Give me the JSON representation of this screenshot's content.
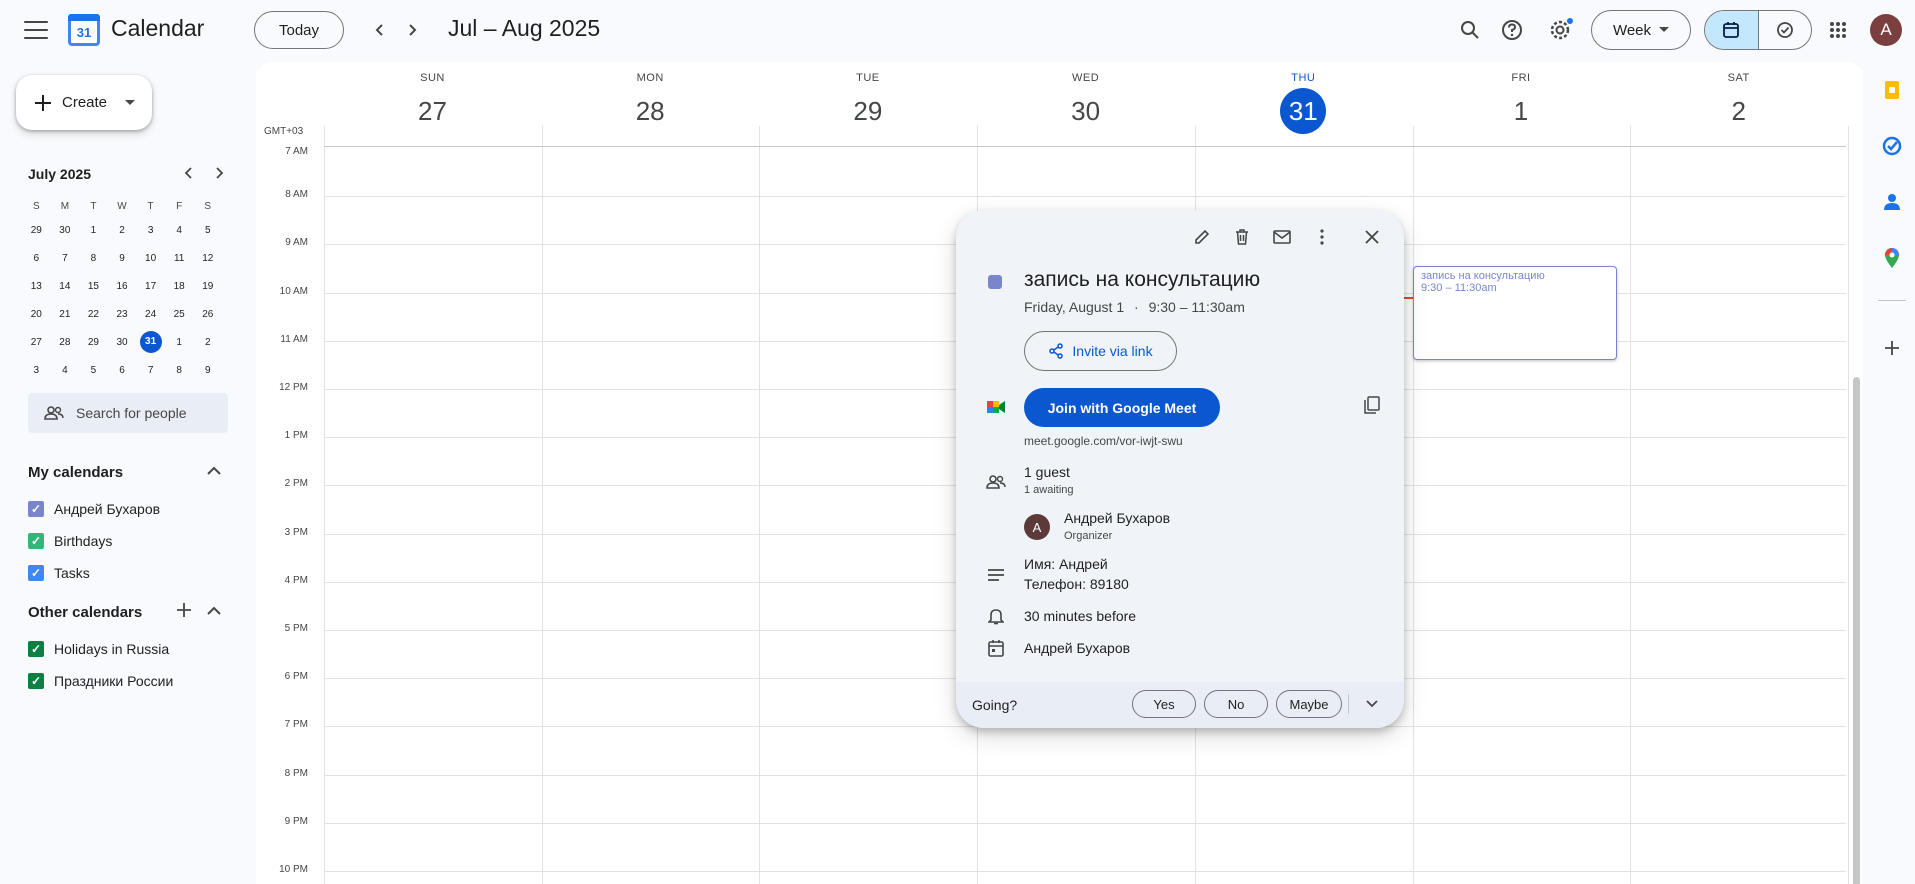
{
  "app": {
    "title": "Calendar",
    "logo_day": "31"
  },
  "toolbar": {
    "today": "Today",
    "date_range": "Jul – Aug 2025",
    "view": "Week",
    "avatar_letter": "A"
  },
  "sidebar": {
    "create": "Create",
    "mini_month": "July 2025",
    "mini_weekdays": [
      "S",
      "M",
      "T",
      "W",
      "T",
      "F",
      "S"
    ],
    "mini_weeks": [
      [
        "29",
        "30",
        "1",
        "2",
        "3",
        "4",
        "5"
      ],
      [
        "6",
        "7",
        "8",
        "9",
        "10",
        "11",
        "12"
      ],
      [
        "13",
        "14",
        "15",
        "16",
        "17",
        "18",
        "19"
      ],
      [
        "20",
        "21",
        "22",
        "23",
        "24",
        "25",
        "26"
      ],
      [
        "27",
        "28",
        "29",
        "30",
        "31",
        "1",
        "2"
      ],
      [
        "3",
        "4",
        "5",
        "6",
        "7",
        "8",
        "9"
      ]
    ],
    "search_people": "Search for people",
    "my_calendars_title": "My calendars",
    "my_calendars": [
      {
        "label": "Андрей Бухаров",
        "color": "#7986cb"
      },
      {
        "label": "Birthdays",
        "color": "#33b679"
      },
      {
        "label": "Tasks",
        "color": "#4285f4"
      }
    ],
    "other_calendars_title": "Other calendars",
    "other_calendars": [
      {
        "label": "Holidays in Russia",
        "color": "#0b8043"
      },
      {
        "label": "Праздники России",
        "color": "#0b8043"
      }
    ]
  },
  "week": {
    "timezone": "GMT+03",
    "days": [
      {
        "name": "SUN",
        "date": "27"
      },
      {
        "name": "MON",
        "date": "28"
      },
      {
        "name": "TUE",
        "date": "29"
      },
      {
        "name": "WED",
        "date": "30"
      },
      {
        "name": "THU",
        "date": "31",
        "today": true
      },
      {
        "name": "FRI",
        "date": "1"
      },
      {
        "name": "SAT",
        "date": "2"
      }
    ],
    "hours": [
      "7 AM",
      "8 AM",
      "9 AM",
      "10 AM",
      "11 AM",
      "12 PM",
      "1 PM",
      "2 PM",
      "3 PM",
      "4 PM",
      "5 PM",
      "6 PM",
      "7 PM",
      "8 PM",
      "9 PM",
      "10 PM"
    ]
  },
  "event": {
    "title": "запись на консультацию",
    "time": "9:30 – 11:30am",
    "color": "#7986cb"
  },
  "popup": {
    "title": "запись на консультацию",
    "date": "Friday, August 1",
    "separator": "·",
    "time": "9:30 – 11:30am",
    "invite": "Invite via link",
    "meet_button": "Join with Google Meet",
    "meet_link": "meet.google.com/vor-iwjt-swu",
    "guests": "1 guest",
    "awaiting": "1 awaiting",
    "organizer_name": "Андрей Бухаров",
    "organizer_role": "Organizer",
    "organizer_initial": "A",
    "description_line1": "Имя: Андрей",
    "description_line2": "Телефон: 89180",
    "reminder": "30 minutes before",
    "calendar": "Андрей Бухаров",
    "going": "Going?",
    "yes": "Yes",
    "no": "No",
    "maybe": "Maybe"
  }
}
